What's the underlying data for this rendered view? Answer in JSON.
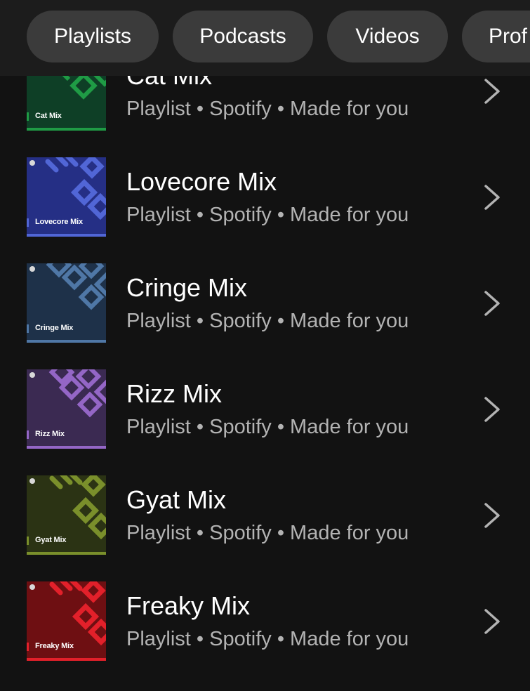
{
  "filters": {
    "chips": [
      {
        "label": "Playlists"
      },
      {
        "label": "Podcasts"
      },
      {
        "label": "Videos"
      },
      {
        "label": "Prof"
      }
    ]
  },
  "library": {
    "items": [
      {
        "title": "Cat Mix",
        "subtitle": "Playlist • Spotify • Made for you",
        "cover_label": "Cat Mix",
        "bg": "#0e3f26",
        "accent": "#1f9b45"
      },
      {
        "title": "Lovecore Mix",
        "subtitle": "Playlist • Spotify • Made for you",
        "cover_label": "Lovecore Mix",
        "bg": "#252f85",
        "accent": "#5166d6"
      },
      {
        "title": "Cringe Mix",
        "subtitle": "Playlist • Spotify • Made for you",
        "cover_label": "Cringe Mix",
        "bg": "#1e3149",
        "accent": "#4f77a6"
      },
      {
        "title": "Rizz Mix",
        "subtitle": "Playlist • Spotify • Made for you",
        "cover_label": "Rizz Mix",
        "bg": "#3b2a52",
        "accent": "#9466c6"
      },
      {
        "title": "Gyat Mix",
        "subtitle": "Playlist • Spotify • Made for you",
        "cover_label": "Gyat Mix",
        "bg": "#2b3314",
        "accent": "#7a8f2b"
      },
      {
        "title": "Freaky Mix",
        "subtitle": "Playlist • Spotify • Made for you",
        "cover_label": "Freaky Mix",
        "bg": "#6e0f12",
        "accent": "#e2202a"
      }
    ]
  },
  "icons": {
    "row_chevron": "chevron-right-icon",
    "cover_logo": "spotify-logo-icon"
  }
}
